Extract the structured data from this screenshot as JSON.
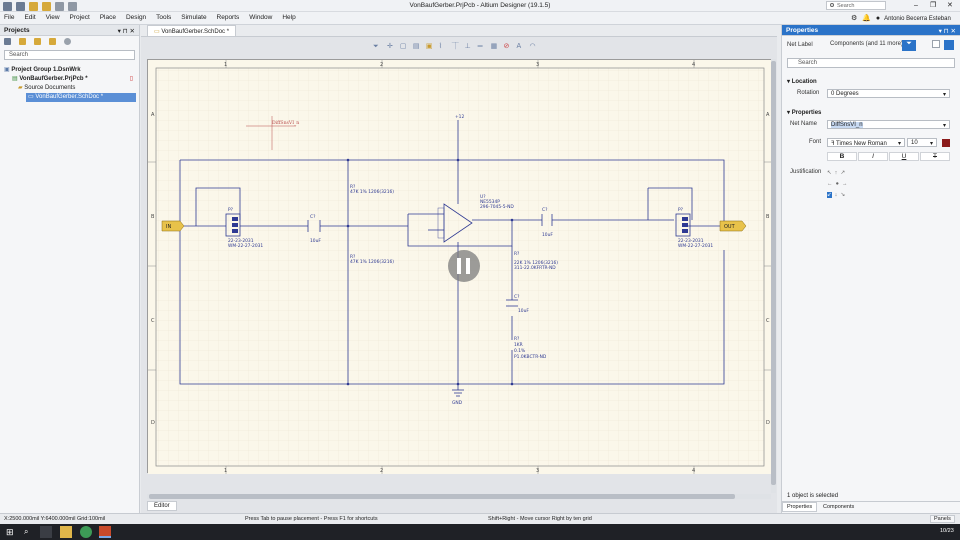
{
  "window": {
    "title": "VonBaufGerber.PrjPcb - Altium Designer (19.1.5)"
  },
  "top_right": {
    "search_placeholder": "Search",
    "user_name": "Antonio Becerra Esteban"
  },
  "menu": [
    "File",
    "Edit",
    "View",
    "Project",
    "Place",
    "Design",
    "Tools",
    "Simulate",
    "Reports",
    "Window",
    "Help"
  ],
  "projects_panel": {
    "title": "Projects",
    "search_placeholder": "Search",
    "tree": [
      {
        "label": "Project Group 1.DsnWrk",
        "level": 0,
        "selected": false
      },
      {
        "label": "VonBaufGerber.PrjPcb *",
        "level": 1,
        "selected": false
      },
      {
        "label": "Source Documents",
        "level": 2,
        "selected": false
      },
      {
        "label": "VonBaufGerber.SchDoc *",
        "level": 3,
        "selected": true
      }
    ]
  },
  "document": {
    "tab_label": "VonBaufGerber.SchDoc *",
    "col_labels": [
      "1",
      "2",
      "3",
      "4"
    ],
    "row_labels": [
      "A",
      "B",
      "C",
      "D"
    ],
    "placing_label": "DiffSnsVI_n",
    "components": [
      {
        "ref": "R?",
        "value": "47K 1% 1206(3216)"
      },
      {
        "ref": "R?",
        "value": "47K 1% 1206(3216)"
      },
      {
        "ref": "U?",
        "value": "NE5534P"
      },
      {
        "ref": "U?",
        "value": "296-7045-5-ND"
      },
      {
        "ref": "C?",
        "value": "10uF"
      },
      {
        "ref": "C?",
        "value": "10uF"
      },
      {
        "ref": "R?",
        "value": "22K 1% 1206(3216)"
      },
      {
        "ref": "R?",
        "value": "311-22.0KFRTR-ND"
      },
      {
        "ref": "C?",
        "value": "10uF"
      },
      {
        "ref": "R?",
        "value": "1KR"
      },
      {
        "ref": "R?",
        "value": "0.1%"
      },
      {
        "ref": "R?",
        "value": "P1.0KBCTR-ND"
      },
      {
        "ref": "P?",
        "value": "22-23-2031"
      },
      {
        "ref": "P?",
        "value": "WM-22-27-2031"
      },
      {
        "ref": "P?",
        "value": "22-23-2031"
      },
      {
        "ref": "P?",
        "value": "WM-22-27-2031"
      },
      {
        "ref": "",
        "value": "GND"
      },
      {
        "ref": "",
        "value": "+12"
      }
    ],
    "port_in": "IN",
    "port_out": "OUT",
    "bottom_tab": "Editor"
  },
  "properties": {
    "title": "Properties",
    "type_label": "Net Label",
    "filter_text": "Components (and 11 more)",
    "search_placeholder": "Search",
    "section_location": "Location",
    "rotation_label": "Rotation",
    "rotation_value": "0 Degrees",
    "section_properties": "Properties",
    "net_name_label": "Net Name",
    "net_name_value": "DiffSnsVI_n",
    "font_label": "Font",
    "font_value": "Times New Roman",
    "font_size": "10",
    "font_color": "#8b1b1b",
    "bold": "B",
    "italic": "I",
    "underline": "U",
    "strike": "T",
    "justification_label": "Justification",
    "selected_status": "1 object is selected",
    "bottom_tabs": [
      "Properties",
      "Components"
    ]
  },
  "status": {
    "coords": "X:2500.000mil Y:6400.000mil   Grid:100mil",
    "hint1": "Press Tab to pause placement - Press F1 for shortcuts",
    "hint2": "Shift+Right - Move cursor Right by ten grid",
    "panels": "Panels"
  },
  "taskbar": {
    "clock": "10/23"
  },
  "colors": {
    "accent": "#2b73c8",
    "wire": "#2f3a93",
    "sheet": "#fbf7ea",
    "port": "#e8c24a"
  }
}
